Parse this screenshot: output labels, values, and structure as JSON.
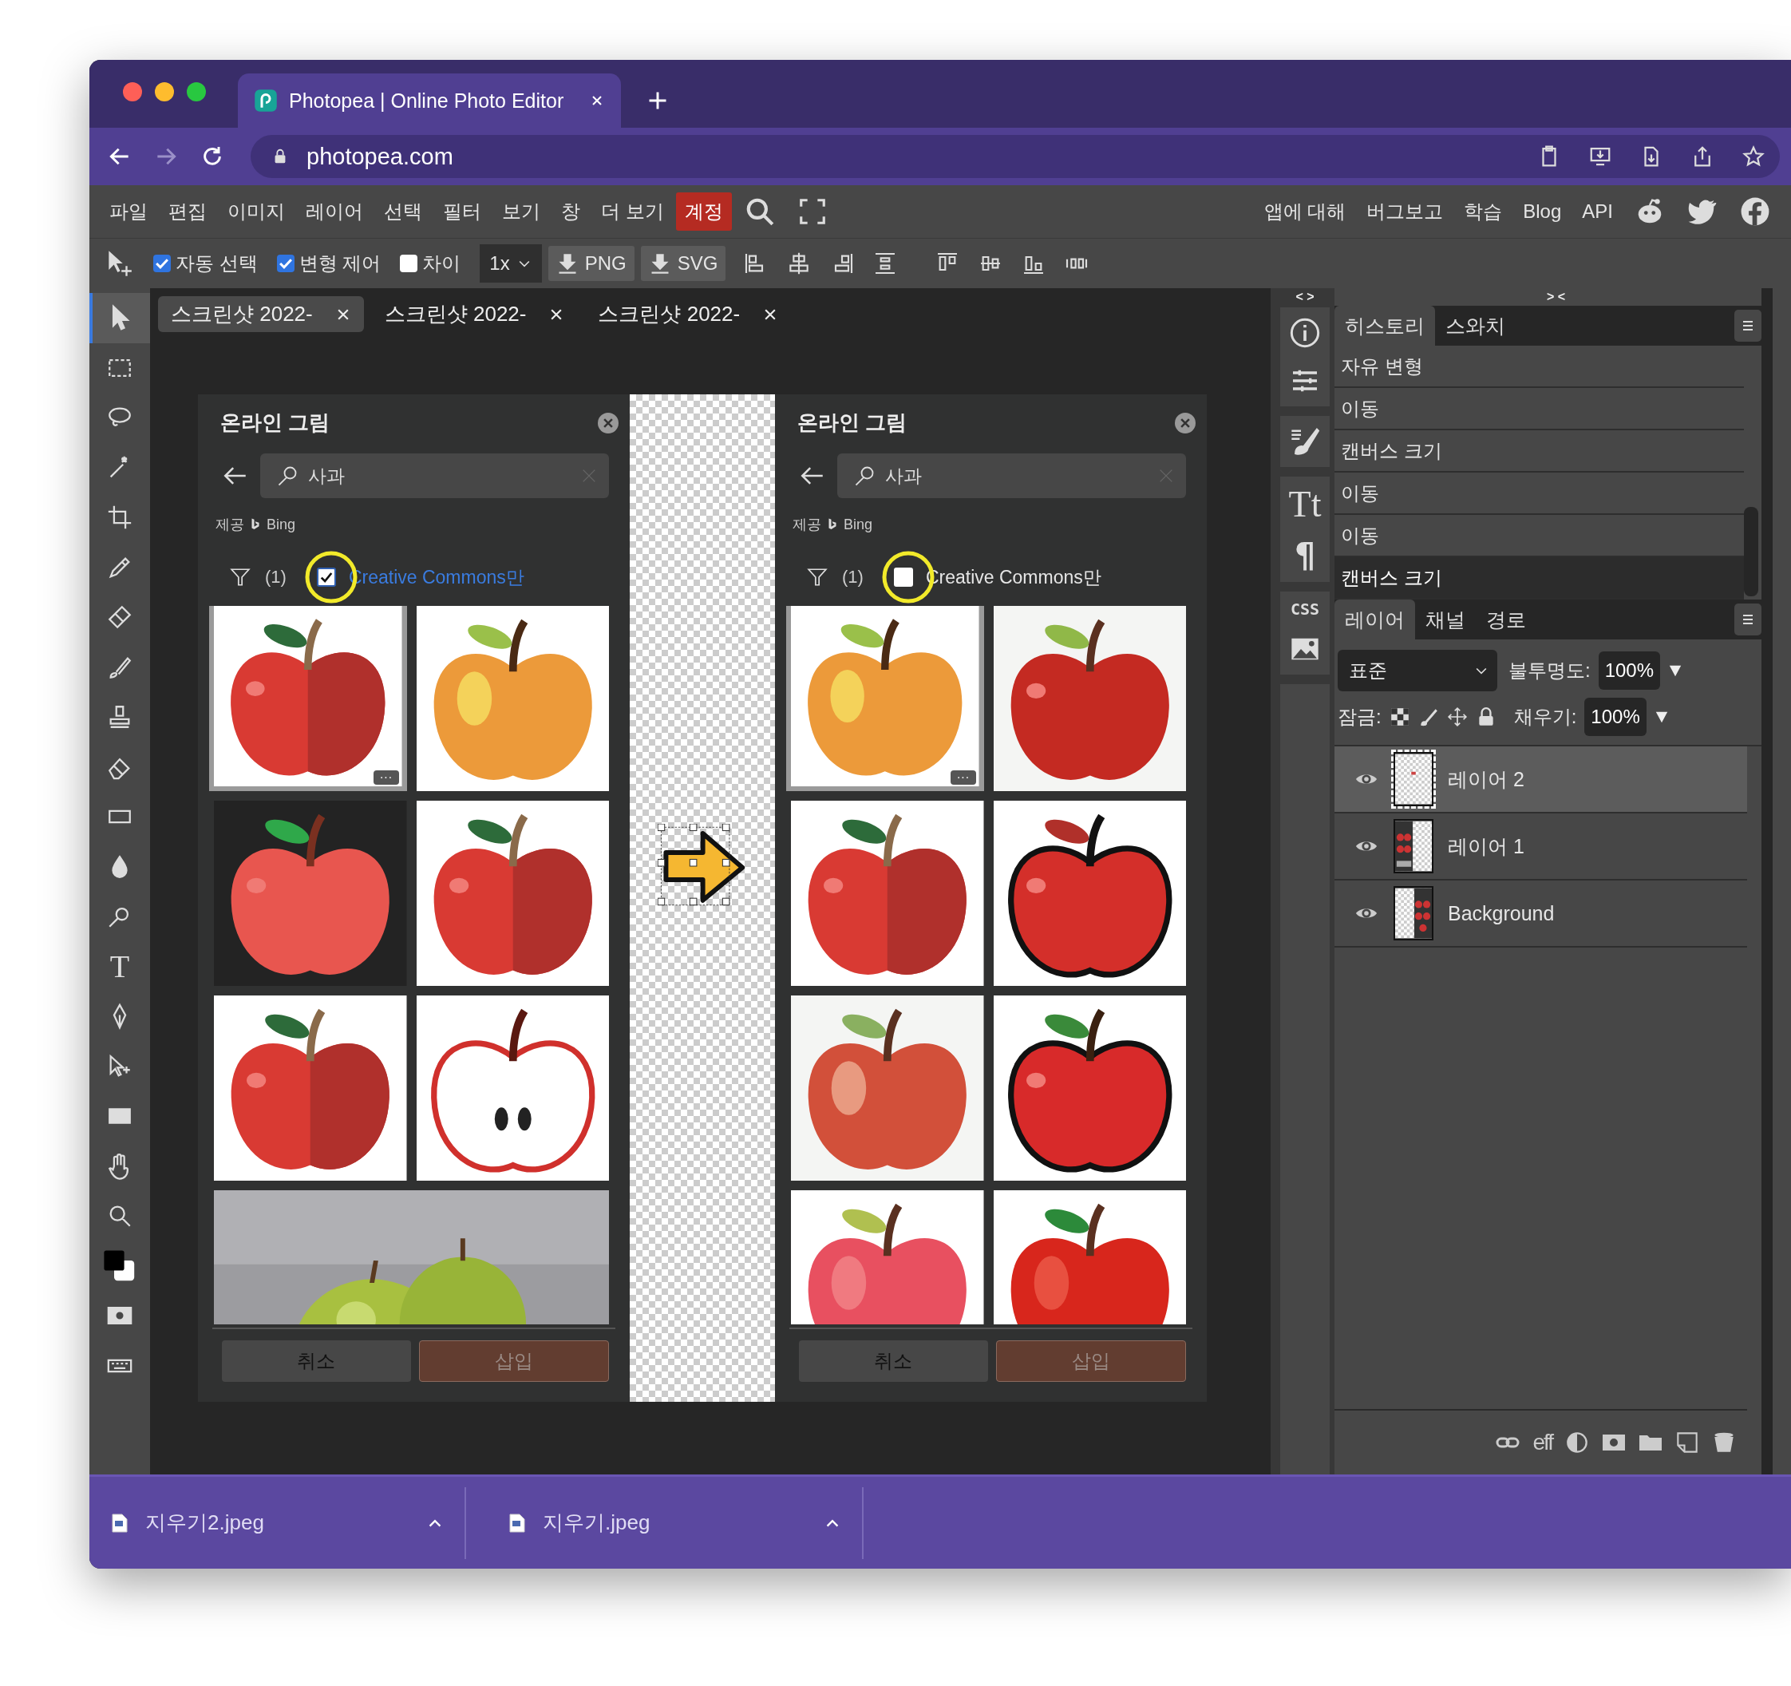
{
  "window": {
    "tab_title": "Photopea | Online Photo Editor",
    "url": "photopea.com"
  },
  "menu": [
    {
      "label": "파일",
      "highlighted": false
    },
    {
      "label": "편집",
      "highlighted": false
    },
    {
      "label": "이미지",
      "highlighted": false
    },
    {
      "label": "레이어",
      "highlighted": false
    },
    {
      "label": "선택",
      "highlighted": false
    },
    {
      "label": "필터",
      "highlighted": false
    },
    {
      "label": "보기",
      "highlighted": false
    },
    {
      "label": "창",
      "highlighted": false
    },
    {
      "label": "더 보기",
      "highlighted": false
    },
    {
      "label": "계정",
      "highlighted": true
    }
  ],
  "menu_links": [
    "앱에 대해",
    "버그보고",
    "학습",
    "Blog",
    "API"
  ],
  "options": {
    "toggles": [
      {
        "label": "자동 선택",
        "checked": true
      },
      {
        "label": "변형 제어",
        "checked": true
      },
      {
        "label": "차이",
        "checked": false
      }
    ],
    "zoom": "1x",
    "exports": [
      "PNG",
      "SVG"
    ]
  },
  "tool_glyphs": {
    "type": "T"
  },
  "doc_tabs": [
    {
      "label": "스크린샷 2022-",
      "selected": true
    },
    {
      "label": "스크린샷 2022-",
      "selected": false
    },
    {
      "label": "스크린샷 2022-",
      "selected": false
    }
  ],
  "dialogs": [
    {
      "title": "온라인 그림",
      "query": "사과",
      "provider_prefix": "제공",
      "provider": "Bing",
      "filter_count": "(1)",
      "cc_label": "Creative Commons만",
      "cc_checked": true,
      "more": "···",
      "cancel": "취소",
      "insert": "삽입",
      "images": [
        {
          "selected": true,
          "wide": false
        },
        {
          "selected": false,
          "wide": false
        },
        {
          "selected": false,
          "wide": false
        },
        {
          "selected": false,
          "wide": false
        },
        {
          "selected": false,
          "wide": false
        },
        {
          "selected": false,
          "wide": false
        },
        {
          "selected": false,
          "wide": true
        }
      ]
    },
    {
      "title": "온라인 그림",
      "query": "사과",
      "provider_prefix": "제공",
      "provider": "Bing",
      "filter_count": "(1)",
      "cc_label": "Creative Commons만",
      "cc_checked": false,
      "more": "···",
      "cancel": "취소",
      "insert": "삽입",
      "images": [
        {
          "selected": true,
          "wide": false
        },
        {
          "selected": false,
          "wide": false
        },
        {
          "selected": false,
          "wide": false
        },
        {
          "selected": false,
          "wide": false
        },
        {
          "selected": false,
          "wide": false
        },
        {
          "selected": false,
          "wide": false
        },
        {
          "selected": false,
          "wide": false
        },
        {
          "selected": false,
          "wide": false
        }
      ]
    }
  ],
  "dock": {
    "expand": "< >",
    "glyphs": [
      "Tt",
      "¶",
      "CSS"
    ]
  },
  "history": {
    "collapse": "> <",
    "tabs": [
      {
        "label": "히스토리",
        "selected": true
      },
      {
        "label": "스와치",
        "selected": false
      }
    ],
    "items": [
      {
        "label": "자유 변형",
        "selected": false
      },
      {
        "label": "이동",
        "selected": false
      },
      {
        "label": "캔버스 크기",
        "selected": false
      },
      {
        "label": "이동",
        "selected": false
      },
      {
        "label": "이동",
        "selected": false
      },
      {
        "label": "캔버스 크기",
        "selected": true
      }
    ]
  },
  "layers": {
    "tabs": [
      {
        "label": "레이어",
        "selected": true
      },
      {
        "label": "채널",
        "selected": false
      },
      {
        "label": "경로",
        "selected": false
      }
    ],
    "blend": "표준",
    "opacity_label": "불투명도:",
    "opacity": "100%",
    "lock_label": "잠금:",
    "fill_label": "채우기:",
    "fill": "100%",
    "fx": "eff",
    "items": [
      {
        "name": "레이어 2",
        "selected": true,
        "visible": true
      },
      {
        "name": "레이어 1",
        "selected": false,
        "visible": true
      },
      {
        "name": "Background",
        "selected": false,
        "visible": true
      }
    ]
  },
  "downloads": [
    {
      "name": "지우기2.jpeg"
    },
    {
      "name": "지우기.jpeg"
    }
  ]
}
